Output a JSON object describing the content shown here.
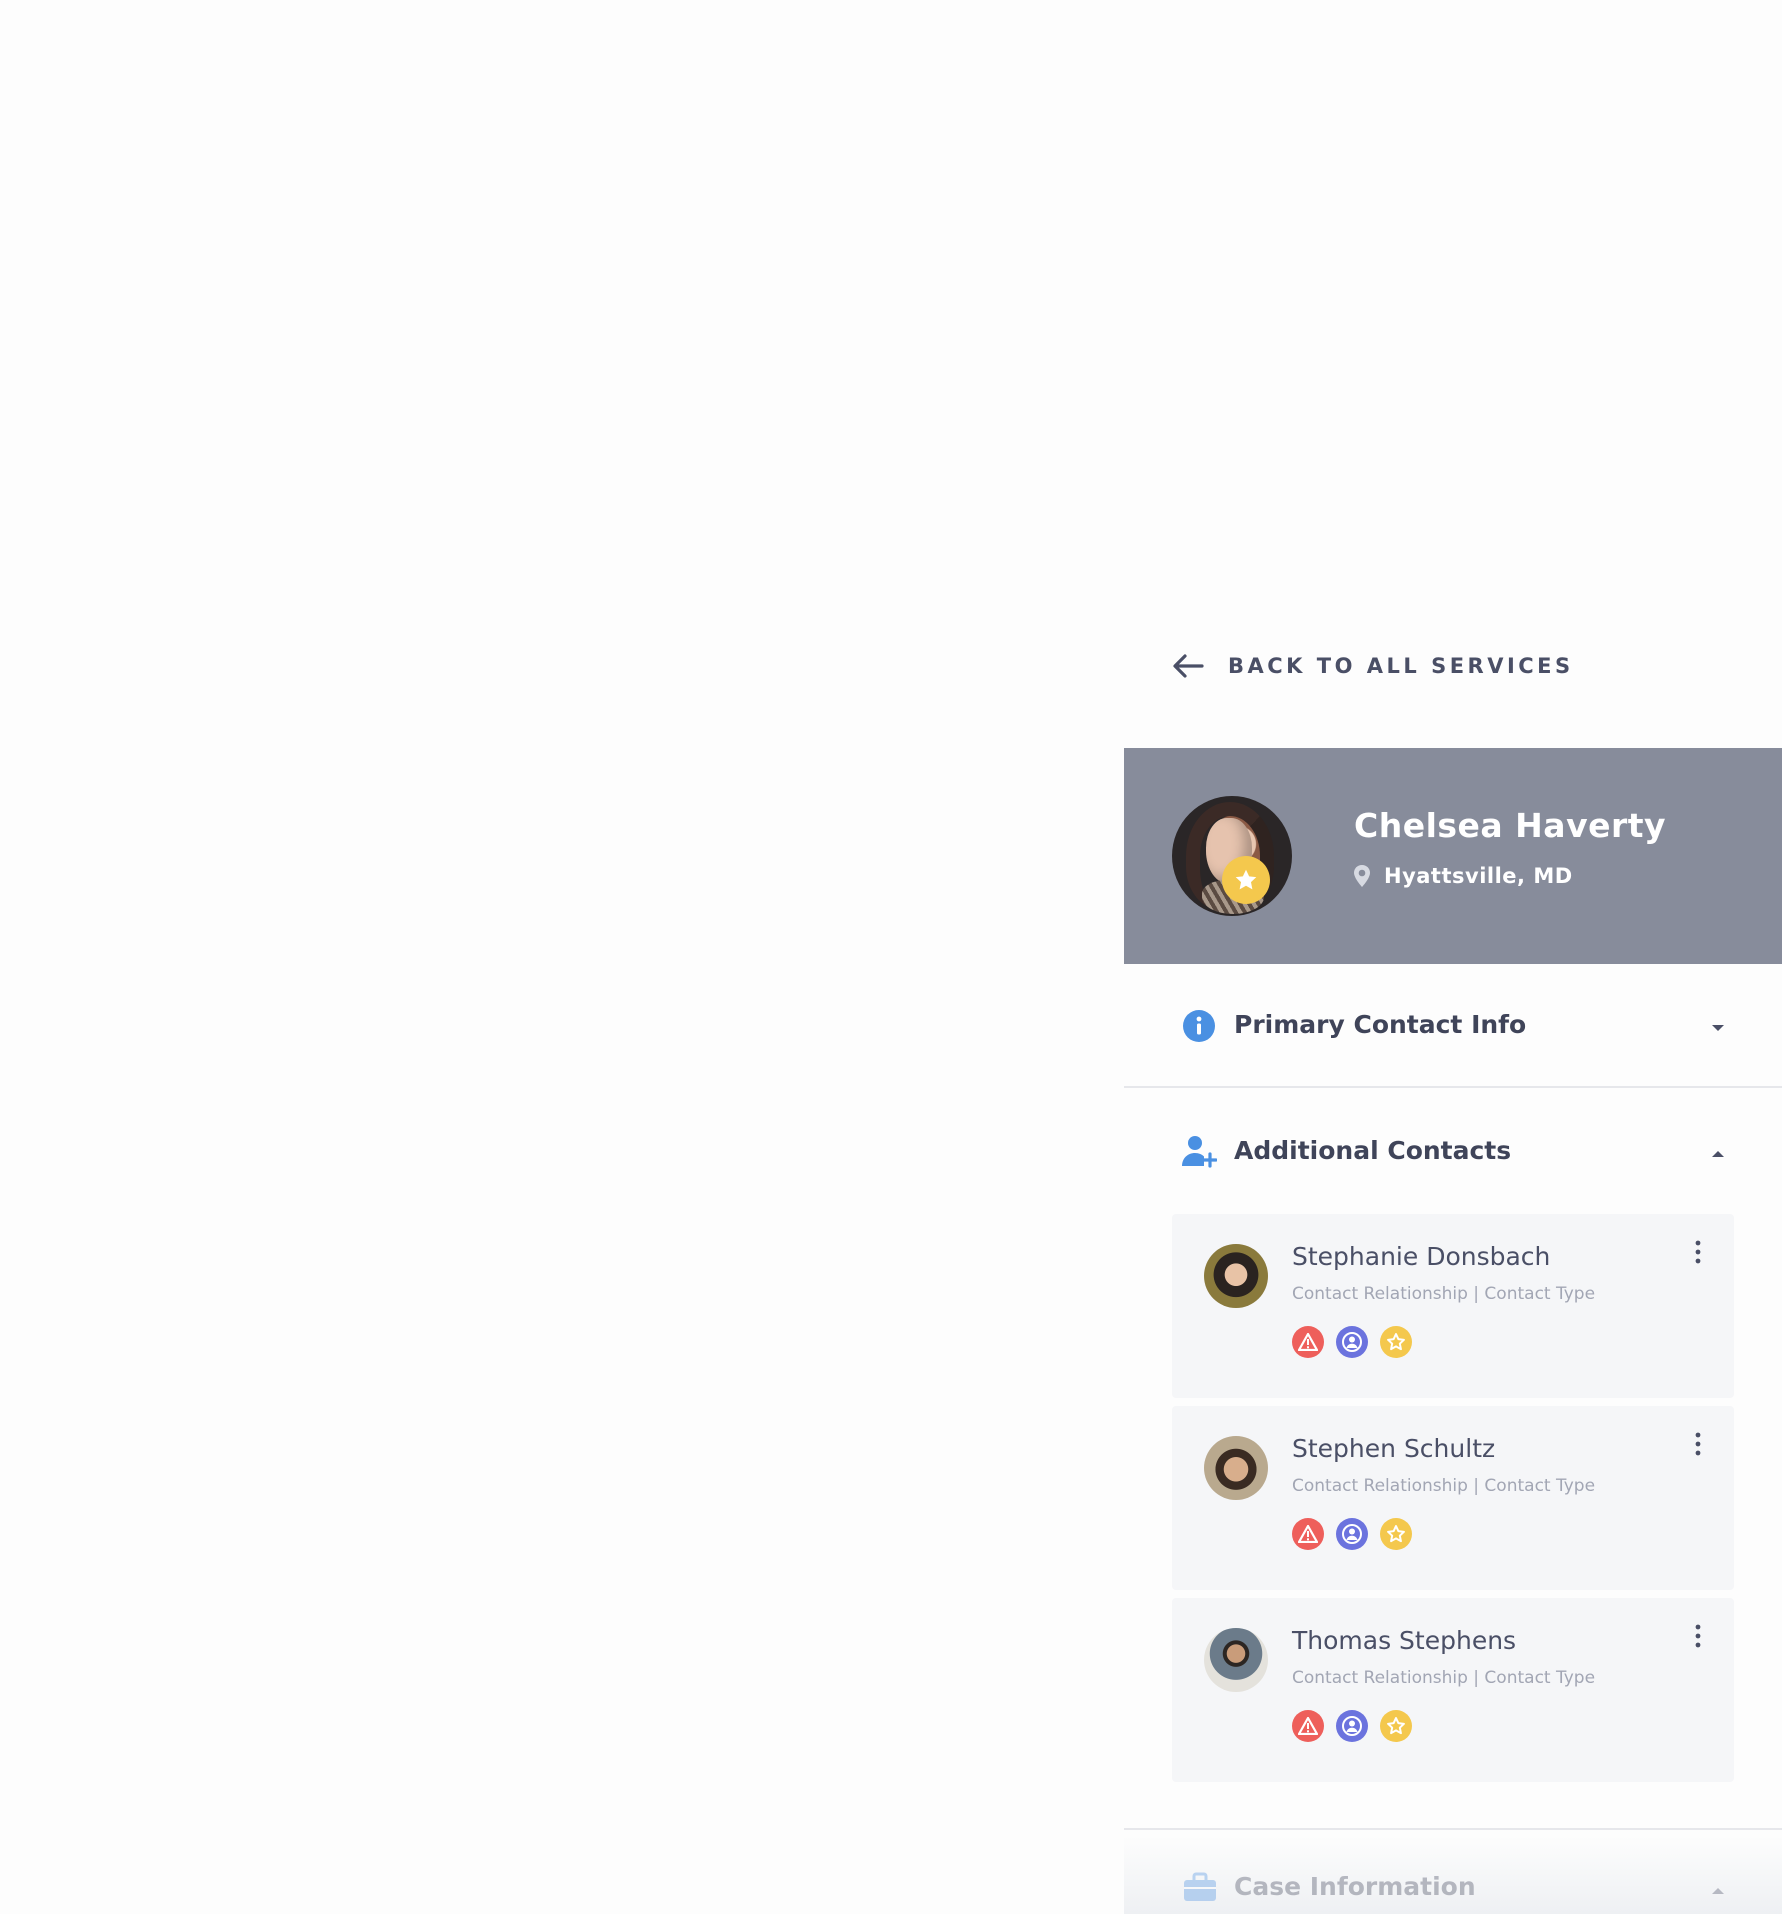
{
  "back_link": {
    "label": "BACK TO ALL SERVICES",
    "icon": "arrow-left-icon"
  },
  "profile": {
    "name": "Chelsea Haverty",
    "location": "Hyattsville, MD",
    "location_icon": "location-pin-icon",
    "badge_icon": "star-icon",
    "header_color": "#878c9b"
  },
  "sections": {
    "primary": {
      "title": "Primary Contact Info",
      "icon": "info-icon",
      "state": "collapsed"
    },
    "additional": {
      "title": "Additional Contacts",
      "icon": "add-user-icon",
      "state": "expanded"
    },
    "case": {
      "title": "Case Information",
      "icon": "briefcase-icon",
      "state": "collapsed"
    }
  },
  "contacts": [
    {
      "name": "Stephanie Donsbach",
      "subtitle": "Contact Relationship | Contact Type"
    },
    {
      "name": "Stephen Schultz",
      "subtitle": "Contact Relationship | Contact Type"
    },
    {
      "name": "Thomas Stephens",
      "subtitle": "Contact Relationship | Contact Type"
    }
  ],
  "badge_colors": {
    "alert": "#ee5f5b",
    "person": "#6b73de",
    "star": "#f4c84d"
  },
  "accent_color": "#4a90e2"
}
